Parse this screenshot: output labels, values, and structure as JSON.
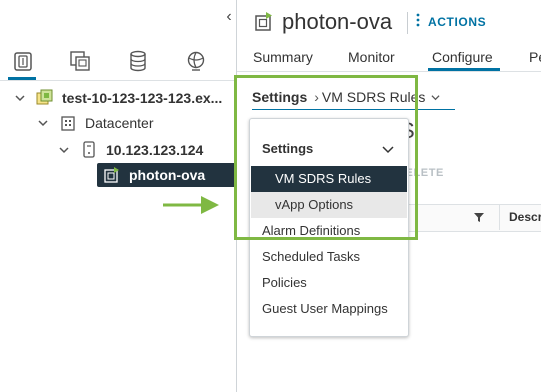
{
  "navigator": {
    "collapse_glyph": "‹",
    "tabs": [
      {
        "name": "hosts-and-clusters",
        "icon": "hosts-clusters-icon"
      },
      {
        "name": "vms-and-templates",
        "icon": "vms-templates-icon"
      },
      {
        "name": "storage",
        "icon": "storage-icon"
      },
      {
        "name": "networking",
        "icon": "networking-icon"
      }
    ],
    "tree": {
      "vcenter": "test-10-123-123-123.ex...",
      "datacenter": "Datacenter",
      "host": "10.123.123.124",
      "vm": "photon-ova"
    }
  },
  "header": {
    "title": "photon-ova",
    "actions_label": "ACTIONS"
  },
  "tabs": [
    {
      "label": "Summary"
    },
    {
      "label": "Monitor"
    },
    {
      "label": "Configure"
    },
    {
      "label": "Pe"
    }
  ],
  "breadcrumb": {
    "root": "Settings",
    "separator": "›",
    "current": "VM SDRS Rules"
  },
  "background": {
    "heading_fragment": "S",
    "delete_fragment": "DELETE",
    "descr_column": "Descr"
  },
  "dropdown": {
    "header": "Settings",
    "items": [
      {
        "label": "VM SDRS Rules",
        "state": "selected"
      },
      {
        "label": "vApp Options",
        "state": "hover"
      }
    ],
    "other_items": [
      {
        "label": "Alarm Definitions"
      },
      {
        "label": "Scheduled Tasks"
      },
      {
        "label": "Policies"
      },
      {
        "label": "Guest User Mappings"
      }
    ]
  },
  "colors": {
    "accent": "#0072a3",
    "selected_bg": "#22333f",
    "highlight_green": "#7fb843"
  }
}
